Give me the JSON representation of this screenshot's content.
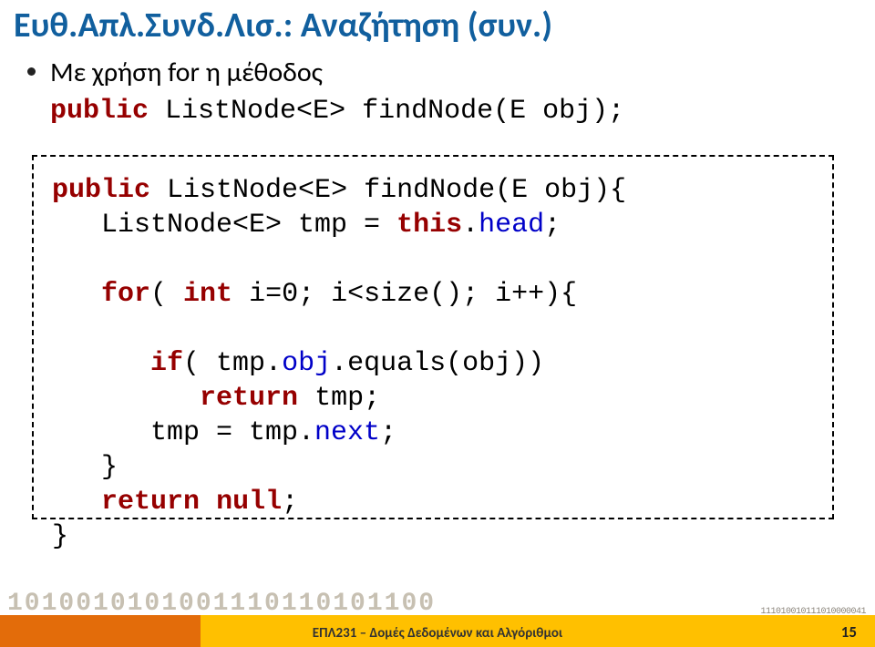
{
  "title": "Ευθ.Απλ.Συνδ.Λισ.: Αναζήτηση (συν.)",
  "bullet": {
    "intro": "Με χρήση for η μέθοδος",
    "kw_public": "public",
    "rest": " ListNode<E> findNode(E obj);"
  },
  "code": {
    "kw_public": "public",
    "sig_rest": " ListNode<E> findNode(E obj){",
    "line2a": "   ListNode<E> tmp = ",
    "kw_this": "this",
    "line2b": ".",
    "attr_head": "head",
    "line2c": ";",
    "blank1": "",
    "line3a": "   ",
    "kw_for": "for",
    "line3b": "( ",
    "kw_int": "int",
    "line3c": " i=0; i<size(); i++){",
    "blank2": "",
    "line4a": "      ",
    "kw_if": "if",
    "line4b": "( tmp.",
    "attr_obj": "obj",
    "line4c": ".equals(obj))",
    "line5a": "         ",
    "kw_return1": "return",
    "line5b": " tmp;",
    "line6a": "      tmp = tmp.",
    "attr_next": "next",
    "line6b": ";",
    "line7": "   }",
    "line8a": "   ",
    "kw_return2": "return",
    "line8b": " ",
    "kw_null": "null",
    "line8c": ";",
    "line9": "}"
  },
  "footer": {
    "binary_big": "1010010101001110110101100",
    "binary_small": "111010010111010000041",
    "text": "ΕΠΛ231 – Δομές Δεδομένων και Αλγόριθμοι",
    "page": "15"
  }
}
